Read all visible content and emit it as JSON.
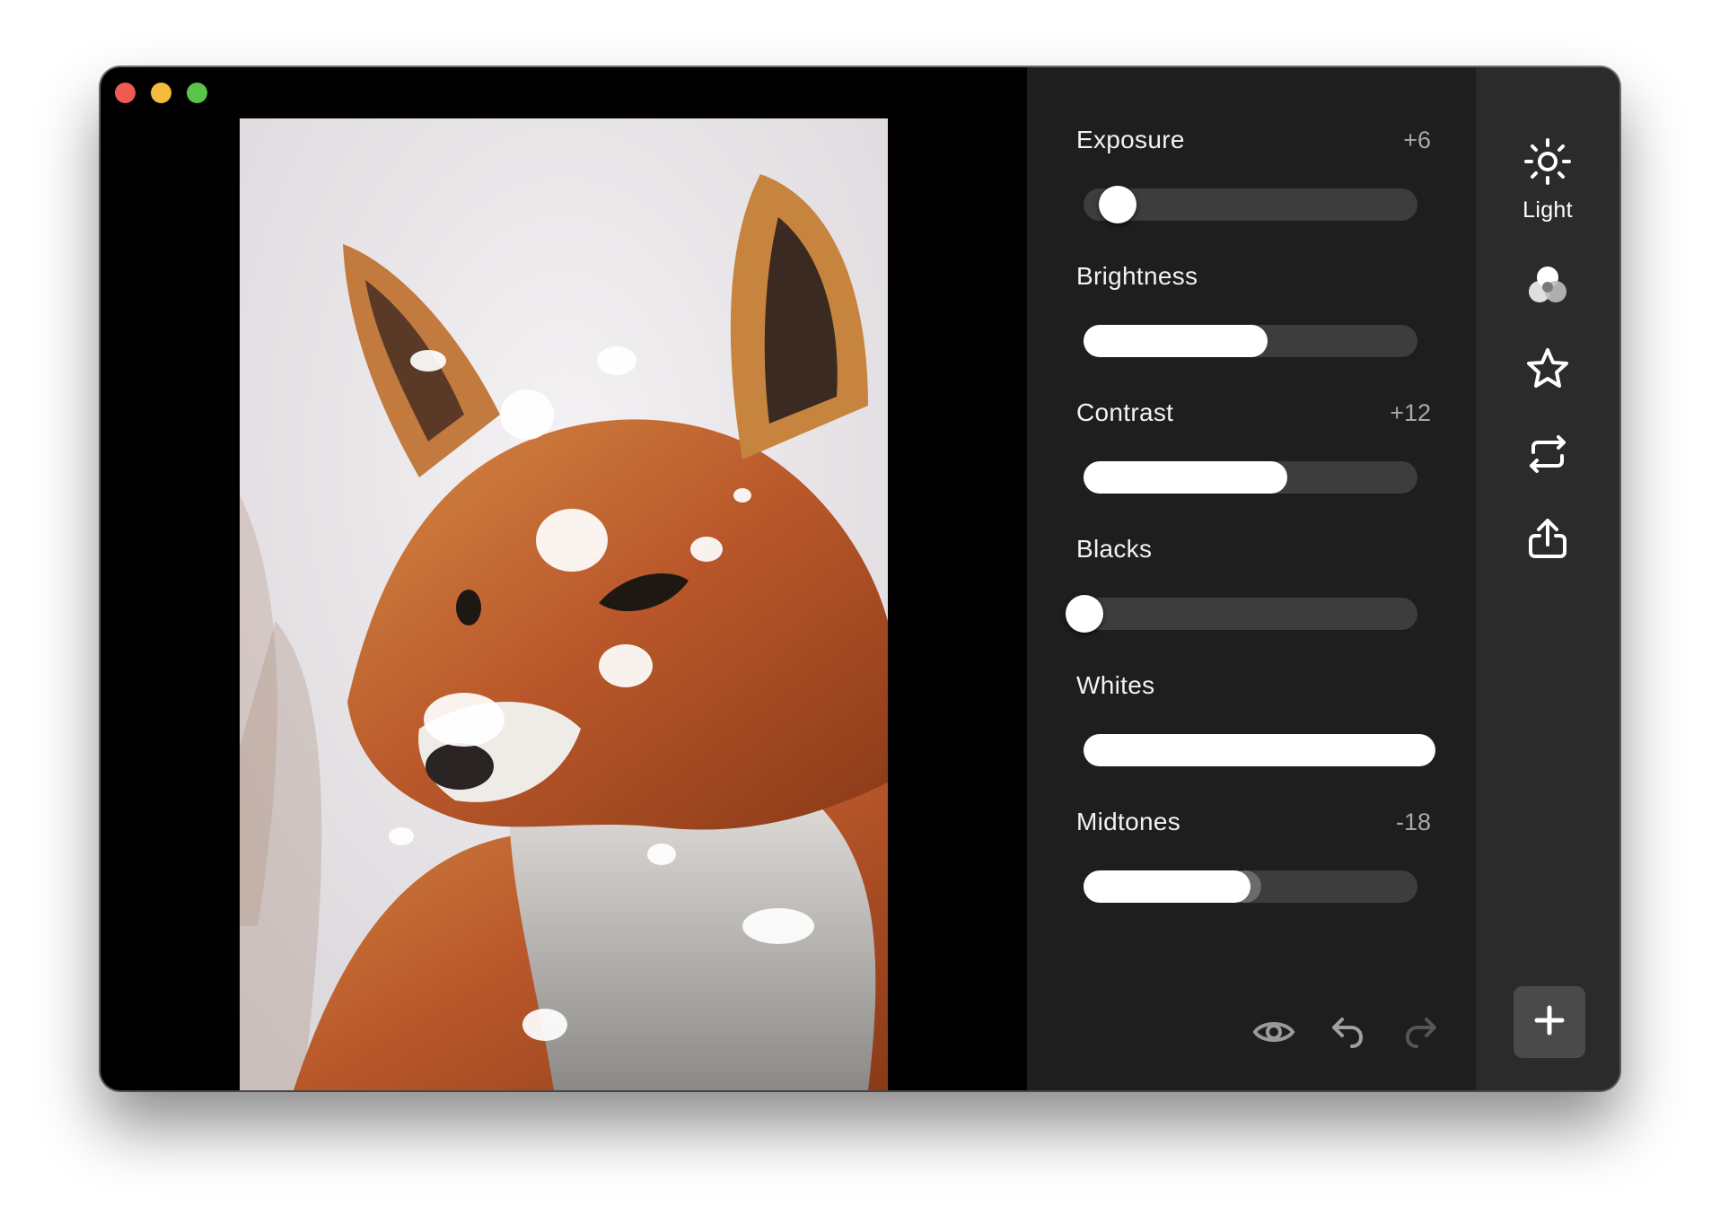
{
  "adjustments": [
    {
      "label": "Exposure",
      "value": "+6",
      "level": 0.05,
      "style": "knob"
    },
    {
      "label": "Brightness",
      "value": "",
      "level": 0.55,
      "style": "fill"
    },
    {
      "label": "Contrast",
      "value": "+12",
      "level": 0.61,
      "style": "fill"
    },
    {
      "label": "Blacks",
      "value": "",
      "level": 0.0,
      "style": "knob"
    },
    {
      "label": "Whites",
      "value": "",
      "level": 1.0,
      "style": "fill"
    },
    {
      "label": "Midtones",
      "value": "-18",
      "level": 0.5,
      "style": "fill"
    }
  ],
  "rail": {
    "light_label": "Light",
    "tools": [
      "sun-icon",
      "color-circles-icon",
      "star-icon",
      "crop-icon",
      "share-icon"
    ]
  },
  "bottom_tools": [
    "eye-icon",
    "undo-icon",
    "redo-icon"
  ],
  "add_button_icon": "plus-icon",
  "colors": {
    "panel": "#1e1e1e",
    "rail": "#2b2b2b",
    "track": "#3d3d3d",
    "fill": "#ffffff"
  }
}
